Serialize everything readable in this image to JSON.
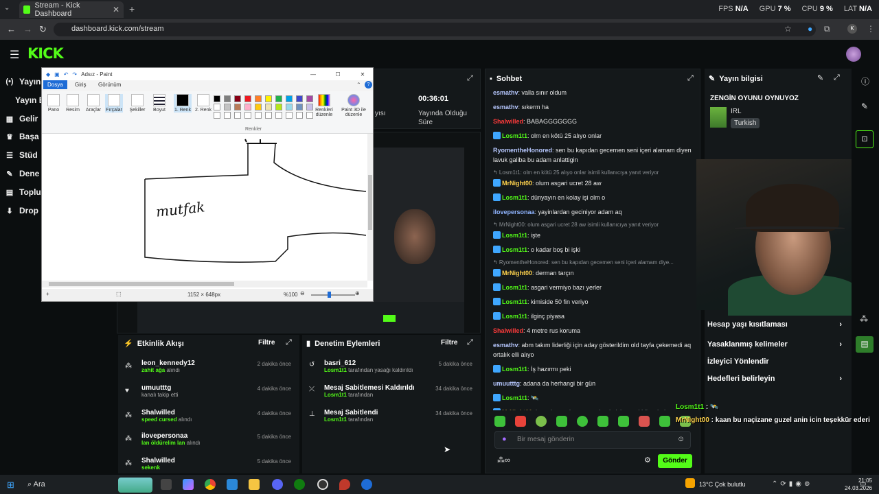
{
  "browser": {
    "tab_title": "Stream - Kick Dashboard",
    "url": "dashboard.kick.com/stream",
    "perf": [
      {
        "k": "FPS",
        "v": "N/A"
      },
      {
        "k": "GPU",
        "v": "7 %"
      },
      {
        "k": "CPU",
        "v": "9 %"
      },
      {
        "k": "LAT",
        "v": "N/A"
      }
    ],
    "profile_letter": "K"
  },
  "header": {
    "logo": "KICK"
  },
  "sidebar": {
    "items": [
      {
        "icon": "(•)",
        "label": "Yayın"
      },
      {
        "icon": "",
        "label": "Yayın B"
      },
      {
        "icon": "▦",
        "label": "Gelir"
      },
      {
        "icon": "♛",
        "label": "Başa"
      },
      {
        "icon": "☰",
        "label": "Stüd"
      },
      {
        "icon": "✎",
        "label": "Dene"
      },
      {
        "icon": "▤",
        "label": "Toplu"
      },
      {
        "icon": "⬇",
        "label": "Drop"
      }
    ]
  },
  "paint": {
    "title": "Adsız - Paint",
    "tabs": [
      "Dosya",
      "Giriş",
      "Görünüm"
    ],
    "tools": [
      "Pano",
      "Resim",
      "Araçlar",
      "Fırçalar",
      "Şekiller",
      "Boyut"
    ],
    "color1": "1. Renk",
    "color2": "2. Renk",
    "colors_group": "Renkler",
    "edit_colors": "Renkleri düzenle",
    "paint3d": "Paint 3D ile düzenle",
    "canvas_text": "mutfak",
    "size": "1152 × 648px",
    "zoom": "%100"
  },
  "stats": {
    "time": "00:36:01",
    "time_label_1": "Yayında Olduğu",
    "time_label_2": "Süre",
    "partial": "yısı"
  },
  "activity": {
    "title": "Etkinlik Akışı",
    "filter": "Filtre",
    "items": [
      {
        "name": "leon_kennedy12",
        "hl": "zahit ağa",
        "rest": " alındı",
        "time": "2 dakika önce"
      },
      {
        "name": "umuutttg",
        "hl": "",
        "rest": "kanalı takip etti",
        "time": "4 dakika önce"
      },
      {
        "name": "Shalwilled",
        "hl": "speed cursed",
        "rest": " alındı",
        "time": "4 dakika önce"
      },
      {
        "name": "ilovepersonaa",
        "hl": "lan öldürelim lan",
        "rest": " alındı",
        "time": "5 dakika önce"
      },
      {
        "name": "Shalwilled",
        "hl": "sekenk",
        "rest": "",
        "time": "5 dakika önce"
      }
    ]
  },
  "moderation": {
    "title": "Denetim Eylemleri",
    "filter": "Filtre",
    "items": [
      {
        "name": "basri_612",
        "hl": "Losm1t1",
        "rest": " tarafından yasağı kaldırıldı",
        "time": "5 dakika önce"
      },
      {
        "name": "Mesaj Sabitlemesi Kaldırıldı",
        "hl": "Losm1t1",
        "rest": " tarafından",
        "time": "34 dakika önce"
      },
      {
        "name": "Mesaj Sabitlendi",
        "hl": "Losm1t1",
        "rest": " tarafından",
        "time": "34 dakika önce"
      }
    ]
  },
  "chat": {
    "title": "Sohbet",
    "input_placeholder": "Bir mesaj gönderin",
    "send": "Gönder",
    "messages": [
      {
        "t": "msg",
        "user": "esmathv",
        "color": "#b7c8ff",
        "text": ": valla sınır oldum"
      },
      {
        "t": "msg",
        "user": "esmathv",
        "color": "#b7c8ff",
        "text": ": sıkerm ha"
      },
      {
        "t": "msg",
        "user": "Shalwilled",
        "color": "#ff3b3b",
        "text": ": BABAGGGGGGG"
      },
      {
        "t": "msg",
        "user": "Losm1t1",
        "color": "#53fc18",
        "badge": true,
        "text": ": olm en kötü 25 alıyo onlar"
      },
      {
        "t": "msg",
        "user": "RyomentheHonored",
        "color": "#b7c8ff",
        "text": ": sen bu kapıdan gecemen seni içeri alamam diyen lavuk galiba bu adam anlattigin",
        "lines": 2
      },
      {
        "t": "reply",
        "text": "↰ Losm1t1: olm en kötü 25 alıyo onlar isimli kullanıcıya yanıt veriyor"
      },
      {
        "t": "msg",
        "user": "MrNight00",
        "color": "#ffd34d",
        "badge": true,
        "text": ": olum asgari ucret 28 aw"
      },
      {
        "t": "msg",
        "user": "Losm1t1",
        "color": "#53fc18",
        "badge": true,
        "text": ": dünyayın en kolay işi olm o"
      },
      {
        "t": "msg",
        "user": "ilovepersonaa",
        "color": "#8fb4ff",
        "text": ": yayinlardan geciniyor adam aq"
      },
      {
        "t": "reply",
        "text": "↰ MrNight00: olum asgari ucret 28 aw isimli kullanıcıya yanıt veriyor"
      },
      {
        "t": "msg",
        "user": "Losm1t1",
        "color": "#53fc18",
        "badge": true,
        "text": ": işte"
      },
      {
        "t": "msg",
        "user": "Losm1t1",
        "color": "#53fc18",
        "badge": true,
        "text": ": o kadar boş bi işki"
      },
      {
        "t": "reply",
        "text": "↰ RyomentheHonored: sen bu kapıdan gecemen seni içeri alamam diye..."
      },
      {
        "t": "msg",
        "user": "MrNight00",
        "color": "#ffd34d",
        "badge": true,
        "text": ": derman tarçın"
      },
      {
        "t": "msg",
        "user": "Losm1t1",
        "color": "#53fc18",
        "badge": true,
        "text": ": asgari vermiyo bazı yerler"
      },
      {
        "t": "msg",
        "user": "Losm1t1",
        "color": "#53fc18",
        "badge": true,
        "text": ": kimiside 50 fin veriyo"
      },
      {
        "t": "msg",
        "user": "Losm1t1",
        "color": "#53fc18",
        "badge": true,
        "text": ": ilginç piyasa"
      },
      {
        "t": "msg",
        "user": "Shalwilled",
        "color": "#ff3b3b",
        "text": ": 4 metre rus koruma"
      },
      {
        "t": "msg",
        "user": "esmathv",
        "color": "#b7c8ff",
        "text": ": abm takım liderliği için aday gösterildim old tayfa çekemedi aq ortalık elli alıyo",
        "lines": 2
      },
      {
        "t": "msg",
        "user": "Losm1t1",
        "color": "#53fc18",
        "badge": true,
        "text": ": İş hazırmı peki"
      },
      {
        "t": "msg",
        "user": "umuutttg",
        "color": "#b7c8ff",
        "text": ": adana da herhangi bir gün"
      },
      {
        "t": "msg",
        "user": "Losm1t1",
        "color": "#53fc18",
        "badge": true,
        "text": ": 🛰️"
      },
      {
        "t": "msg",
        "user": "MrNight00",
        "color": "#ffd34d",
        "badge": true,
        "text": ": kaan bu naçizane guzel anin icin teşekkür ederim"
      }
    ]
  },
  "overlay": {
    "line1_user": "Losm1t1",
    "line1_text": " : 🛰️",
    "line2_user": "MrNight00",
    "line2_text": " : kaan bu naçizane guzel anin icin teşekkür ederi"
  },
  "info": {
    "title": "Yayın bilgisi",
    "stream_title": "ZENGİN OYUNU OYNUYOZ",
    "category": "IRL",
    "language": "Turkish",
    "menu": [
      {
        "label": "Hesap yaşı kısıtlaması",
        "arrow": true
      },
      {
        "label": "Yasaklanmış kelimeler",
        "arrow": true
      },
      {
        "label": "İzleyici Yönlendir",
        "arrow": false
      },
      {
        "label": "Hedefleri belirleyin",
        "arrow": true
      }
    ]
  },
  "taskbar": {
    "search": "Ara",
    "weather": "13°C  Çok bulutlu",
    "time": "21:05",
    "date": "24.03.2026"
  },
  "colors": {
    "accent": "#53fc18"
  }
}
